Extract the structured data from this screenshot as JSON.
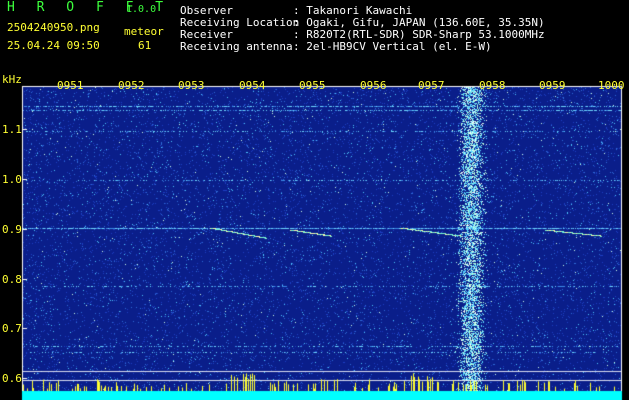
{
  "header": {
    "app_name": "H R O F F T",
    "app_version": "1.0.0",
    "filename": "2504240950.png",
    "datetime": "25.04.24 09:50",
    "detection_label": "meteor",
    "detection_count": "61",
    "info": [
      {
        "key": "Observer",
        "value": ": Takanori Kawachi"
      },
      {
        "key": "Receiving Location",
        "value": ": Ogaki, Gifu, JAPAN (136.60E, 35.35N)"
      },
      {
        "key": "Receiver",
        "value": ": R820T2(RTL-SDR) SDR-Sharp 53.1000MHz"
      },
      {
        "key": "Receiving antenna",
        "value": ": 2el-HB9CV Vertical (el. E-W)"
      }
    ]
  },
  "spectrogram": {
    "y_unit": "kHz",
    "y_ticks": [
      "1.1",
      "1.0",
      "0.9",
      "0.8",
      "0.7",
      "0.6"
    ],
    "time_ticks": [
      "0951",
      "0952",
      "0953",
      "0954",
      "0955",
      "0956",
      "0957",
      "0958",
      "0959",
      "1000"
    ],
    "colors": {
      "background": "#0a1e8a",
      "grid": "#ffffff",
      "label": "#ffff33",
      "baseline": "#00ffff"
    }
  }
}
